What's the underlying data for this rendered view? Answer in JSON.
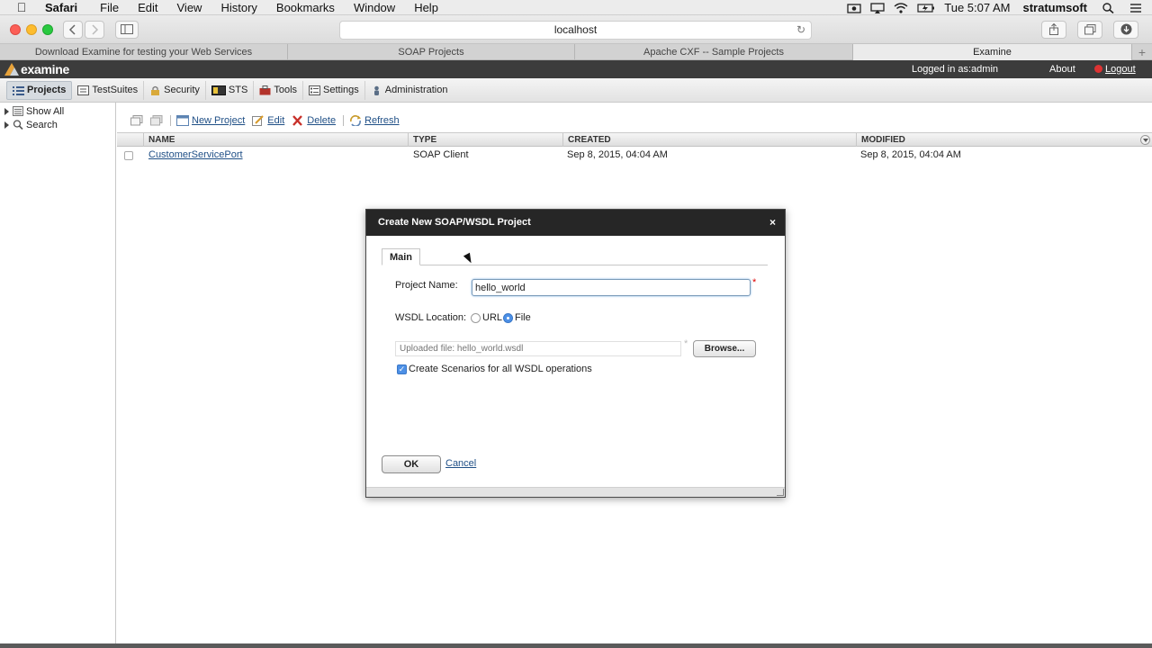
{
  "menubar": {
    "app": "Safari",
    "items": [
      "File",
      "Edit",
      "View",
      "History",
      "Bookmarks",
      "Window",
      "Help"
    ],
    "clock": "Tue 5:07 AM",
    "user": "stratumsoft"
  },
  "browser": {
    "address": "localhost",
    "tabs": [
      {
        "title": "Download Examine for testing your Web Services",
        "active": false
      },
      {
        "title": "SOAP Projects",
        "active": false
      },
      {
        "title": "Apache CXF -- Sample Projects",
        "active": false
      },
      {
        "title": "Examine",
        "active": true
      }
    ]
  },
  "app": {
    "logo_text": "examine",
    "logged_in": "Logged in as:admin",
    "about": "About",
    "logout": "Logout",
    "nav": [
      "Projects",
      "TestSuites",
      "Security",
      "STS",
      "Tools",
      "Settings",
      "Administration"
    ],
    "tree": [
      "Show All",
      "Search"
    ],
    "toolbar": {
      "new_project": "New Project",
      "edit": "Edit",
      "delete": "Delete",
      "refresh": "Refresh"
    },
    "grid": {
      "columns": [
        "NAME",
        "TYPE",
        "CREATED",
        "MODIFIED"
      ],
      "rows": [
        {
          "name": "CustomerServicePort",
          "type": "SOAP Client",
          "created": "Sep 8, 2015, 04:04 AM",
          "modified": "Sep 8, 2015, 04:04 AM"
        }
      ]
    }
  },
  "dialog": {
    "title": "Create New SOAP/WSDL Project",
    "close": "×",
    "tab": "Main",
    "project_name_label": "Project Name:",
    "project_name_value": "hello_world",
    "wsdl_label": "WSDL Location:",
    "radio_url": "URL",
    "radio_file": "File",
    "selected_location": "File",
    "file_placeholder": "Uploaded file: hello_world.wsdl",
    "browse": "Browse...",
    "scenarios_label": "Create Scenarios for all WSDL operations",
    "scenarios_checked": true,
    "ok": "OK",
    "cancel": "Cancel",
    "required_mark": "*"
  },
  "colors": {
    "accent": "#4d90e6",
    "link": "#1f4f86",
    "header": "#3c3c3c",
    "dialog_title": "#262626"
  }
}
